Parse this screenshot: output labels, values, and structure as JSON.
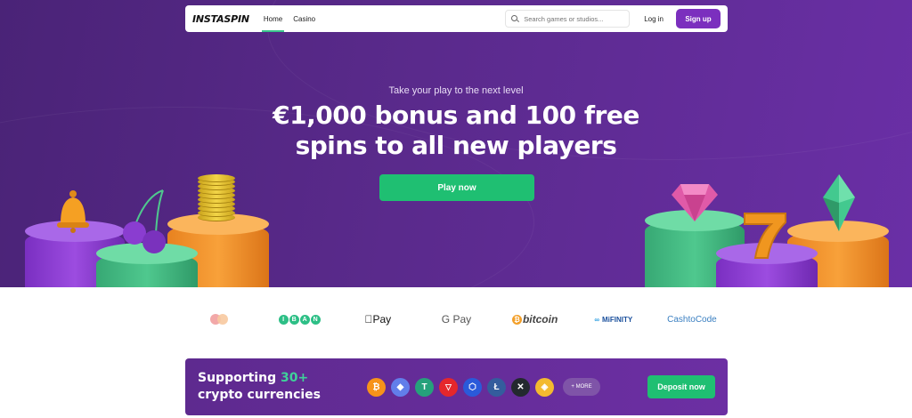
{
  "nav": {
    "logo": "INSTASPIN",
    "tabs": [
      {
        "label": "Home",
        "active": true
      },
      {
        "label": "Casino",
        "active": false
      }
    ],
    "search_placeholder": "Search games or studios...",
    "login_label": "Log in",
    "signup_label": "Sign up"
  },
  "hero": {
    "tagline": "Take your play to the next level",
    "headline_line1": "€1,000 bonus and 100 free",
    "headline_line2": "spins to all new players",
    "cta_label": "Play now"
  },
  "payments": {
    "applepay": "Pay",
    "googlepay": "G Pay",
    "bitcoin": "bitcoin",
    "mifinity": "MiFINITY",
    "cashtocode": "CashtoCode",
    "iban_letters": [
      "I",
      "B",
      "A",
      "N"
    ]
  },
  "crypto_banner": {
    "title_prefix": "Supporting ",
    "title_accent": "30+",
    "title_line2": "crypto currencies",
    "coins": [
      {
        "icon": "bitcoin-icon",
        "glyph": "₿",
        "color": "#f7931a"
      },
      {
        "icon": "ethereum-icon",
        "glyph": "◆",
        "color": "#627eea"
      },
      {
        "icon": "tether-icon",
        "glyph": "T",
        "color": "#26a17b"
      },
      {
        "icon": "tron-icon",
        "glyph": "▽",
        "color": "#e5272c"
      },
      {
        "icon": "chainlink-icon",
        "glyph": "⬡",
        "color": "#2a5ada"
      },
      {
        "icon": "litecoin-icon",
        "glyph": "Ł",
        "color": "#345d9d"
      },
      {
        "icon": "xrp-icon",
        "glyph": "✕",
        "color": "#23292f"
      },
      {
        "icon": "bnb-icon",
        "glyph": "◈",
        "color": "#f3ba2f"
      }
    ],
    "more_label": "+ MORE",
    "deposit_label": "Deposit now"
  },
  "colors": {
    "accent_green": "#1fbf72",
    "brand_purple": "#7b2fbe"
  }
}
